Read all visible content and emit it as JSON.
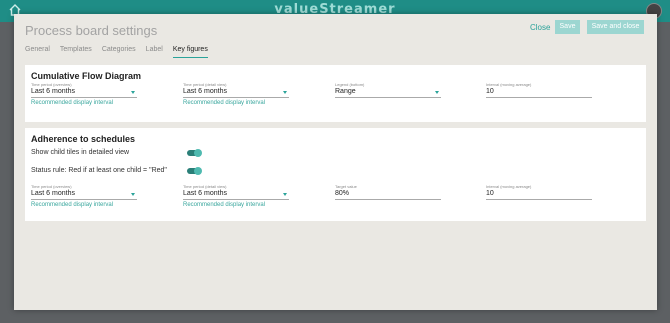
{
  "app": {
    "brand": "valueStreamer",
    "home_icon": "home-icon",
    "avatar_icon": "user-avatar"
  },
  "modal": {
    "title": "Process board settings",
    "close_label": "Close",
    "save_label": "Save",
    "save_close_label": "Save and close"
  },
  "tabs": [
    {
      "label": "General",
      "active": false
    },
    {
      "label": "Templates",
      "active": false
    },
    {
      "label": "Categories",
      "active": false
    },
    {
      "label": "Label",
      "active": false
    },
    {
      "label": "Key figures",
      "active": true
    }
  ],
  "cfd": {
    "title": "Cumulative Flow Diagram",
    "fields": [
      {
        "label": "Time period (overview)",
        "value": "Last 6 months",
        "hint": "Recommended display interval",
        "dropdown": true
      },
      {
        "label": "Time period (detail view)",
        "value": "Last 6 months",
        "hint": "Recommended display interval",
        "dropdown": true
      },
      {
        "label": "Legend (bottom)",
        "value": "Range",
        "hint": "",
        "dropdown": true
      },
      {
        "label": "Interval (moving average)",
        "value": "10",
        "hint": "",
        "dropdown": false
      }
    ]
  },
  "adherence": {
    "title": "Adherence to schedules",
    "toggle1_label": "Show child tiles in detailed view",
    "toggle2_label": "Status rule: Red if at least one child = \"Red\"",
    "toggle1_on": true,
    "toggle2_on": true,
    "fields": [
      {
        "label": "Time period (overview)",
        "value": "Last 6 months",
        "hint": "Recommended display interval",
        "dropdown": true
      },
      {
        "label": "Time period (detail view)",
        "value": "Last 6 months",
        "hint": "Recommended display interval",
        "dropdown": true
      },
      {
        "label": "Target value",
        "value": "80%",
        "hint": "",
        "dropdown": false
      },
      {
        "label": "Interval (moving average)",
        "value": "10",
        "hint": "",
        "dropdown": false
      }
    ]
  },
  "colors": {
    "accent": "#2aa39a",
    "topbar": "#1f8d86",
    "modal_bg": "#eae8e3"
  }
}
